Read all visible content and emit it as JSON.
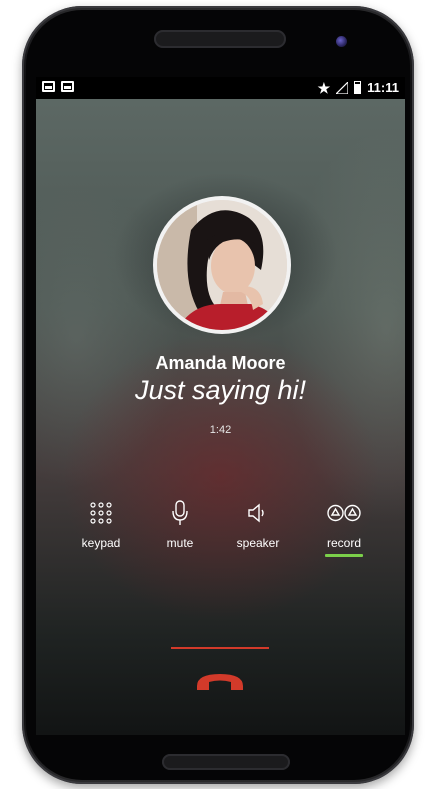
{
  "status_bar": {
    "time": "11:11",
    "left_icons": [
      "message-icon",
      "image-icon"
    ],
    "right_icons": [
      "star-icon",
      "signal-icon",
      "battery-icon"
    ]
  },
  "caller": {
    "name": "Amanda Moore",
    "status_message": "Just saying hi!",
    "duration": "1:42"
  },
  "actions": [
    {
      "label": "keypad",
      "icon": "keypad-icon",
      "active": false
    },
    {
      "label": "mute",
      "icon": "microphone-icon",
      "active": false
    },
    {
      "label": "speaker",
      "icon": "speaker-icon",
      "active": false
    },
    {
      "label": "record",
      "icon": "record-icon",
      "active": true
    }
  ],
  "end_call": {
    "icon": "end-call-icon"
  },
  "colors": {
    "end_call_red": "#d23a2a",
    "record_active_green": "#7bd04a",
    "text": "#ffffff"
  }
}
